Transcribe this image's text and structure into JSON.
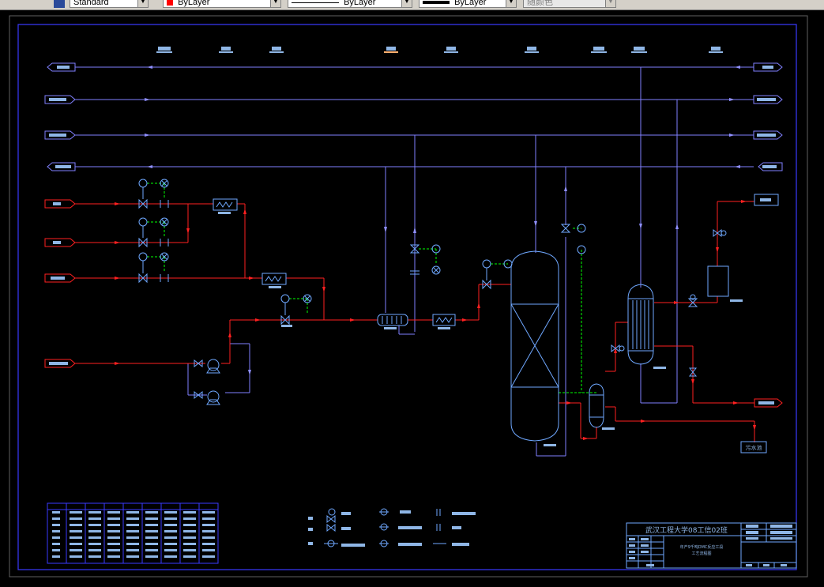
{
  "toolbar": {
    "text_style": "Standard",
    "color": "ByLayer",
    "color_swatch": "#ff0000",
    "linetype": "ByLayer",
    "lineweight": "ByLayer",
    "plot_style": "随颜色"
  },
  "drawing": {
    "title_block": {
      "school": "武汉工程大学08工信02班",
      "drawing_name_1": "年产9千吨DMC反应工段",
      "drawing_name_2": "工艺流程图"
    },
    "destination_label": "污水池"
  },
  "colors": {
    "utility_line": "#8080ff",
    "process_line": "#ff2020",
    "equipment": "#6fa8ff",
    "signal_line": "#00ff00",
    "frame": "#4040ff",
    "label_fill": "#8fb6e6"
  }
}
